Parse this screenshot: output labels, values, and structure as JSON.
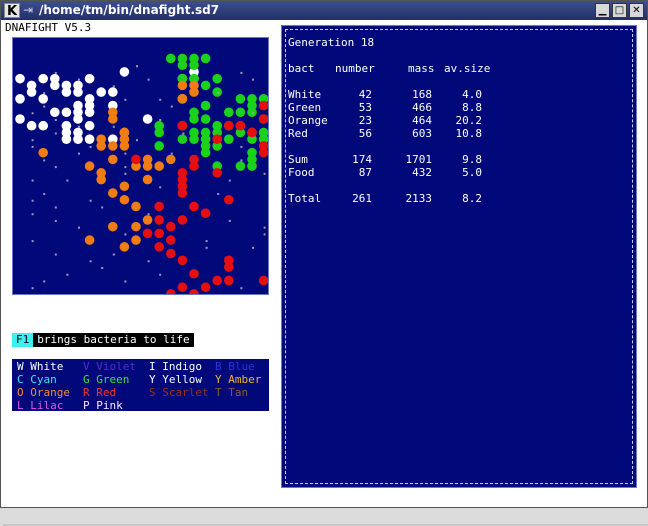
{
  "window": {
    "title": "/home/tm/bin/dnafight.sd7",
    "app_icon": "K",
    "buttons": [
      "minimize",
      "maximize",
      "close"
    ]
  },
  "app": {
    "title": "DNAFIGHT V5.3"
  },
  "colors": {
    "field_bg": "#00087a",
    "white": "#ffffff",
    "green": "#19d219",
    "orange": "#f07d14",
    "red": "#e60f0f",
    "food": "#9a9ab8"
  },
  "hint": {
    "key": "F1",
    "text": "brings bacteria to life"
  },
  "legend": [
    {
      "letter": "W",
      "name": "White",
      "color": "#ffffff"
    },
    {
      "letter": "V",
      "name": "Violet",
      "color": "#5a2ad2"
    },
    {
      "letter": "I",
      "name": "Indigo",
      "color": "#ffffff"
    },
    {
      "letter": "B",
      "name": "Blue",
      "color": "#2a34d8"
    },
    {
      "letter": "C",
      "name": "Cyan",
      "color": "#3ce6f0"
    },
    {
      "letter": "G",
      "name": "Green",
      "color": "#32e632"
    },
    {
      "letter": "Y",
      "name": "Yellow",
      "color": "#ffffff"
    },
    {
      "letter": "Y",
      "name": "Amber",
      "color": "#f0b432"
    },
    {
      "letter": "O",
      "name": "Orange",
      "color": "#f08c32"
    },
    {
      "letter": "R",
      "name": "Red",
      "color": "#f03232"
    },
    {
      "letter": "S",
      "name": "Scarlet",
      "color": "#96321e"
    },
    {
      "letter": "T",
      "name": "Tan",
      "color": "#8c5a32"
    },
    {
      "letter": "L",
      "name": "Lilac",
      "color": "#e650f0"
    },
    {
      "letter": "P",
      "name": "Pink",
      "color": "#ffe6ff"
    }
  ],
  "stats": {
    "generation": "Generation 18",
    "headers": [
      "bact",
      "number",
      "mass",
      "av.size"
    ],
    "rows": [
      {
        "name": "White",
        "number": "42",
        "mass": "168",
        "avsize": "4.0"
      },
      {
        "name": "Green",
        "number": "53",
        "mass": "466",
        "avsize": "8.8"
      },
      {
        "name": "Orange",
        "number": "23",
        "mass": "464",
        "avsize": "20.2"
      },
      {
        "name": "Red",
        "number": "56",
        "mass": "603",
        "avsize": "10.8"
      }
    ],
    "summary": [
      {
        "name": "Sum",
        "number": "174",
        "mass": "1701",
        "avsize": "9.8"
      },
      {
        "name": "Food",
        "number": "87",
        "mass": "432",
        "avsize": "5.0"
      }
    ],
    "total": {
      "name": "Total",
      "number": "261",
      "mass": "2133",
      "avsize": "8.2"
    }
  },
  "field": {
    "bacteria": {
      "white": [
        [
          4,
          9
        ],
        [
          4,
          15
        ],
        [
          5,
          0
        ],
        [
          5,
          2
        ],
        [
          5,
          3
        ],
        [
          5,
          6
        ],
        [
          5,
          14
        ],
        [
          5,
          15
        ],
        [
          6,
          1
        ],
        [
          6,
          3
        ],
        [
          6,
          4
        ],
        [
          6,
          5
        ],
        [
          7,
          1
        ],
        [
          7,
          4
        ],
        [
          7,
          5
        ],
        [
          7,
          7
        ],
        [
          7,
          8
        ],
        [
          8,
          0
        ],
        [
          8,
          2
        ],
        [
          8,
          6
        ],
        [
          8,
          14
        ],
        [
          9,
          5
        ],
        [
          9,
          6
        ],
        [
          9,
          8
        ],
        [
          10,
          3
        ],
        [
          10,
          4
        ],
        [
          10,
          5
        ],
        [
          10,
          6
        ],
        [
          11,
          0
        ],
        [
          11,
          5
        ],
        [
          11,
          11
        ],
        [
          12,
          1
        ],
        [
          12,
          2
        ],
        [
          12,
          4
        ],
        [
          12,
          6
        ],
        [
          13,
          4
        ],
        [
          13,
          5
        ],
        [
          13,
          9
        ],
        [
          14,
          4
        ],
        [
          14,
          5
        ],
        [
          14,
          6
        ],
        [
          14,
          8
        ]
      ],
      "green": [
        [
          2,
          13
        ],
        [
          2,
          14
        ],
        [
          2,
          15
        ],
        [
          2,
          16
        ],
        [
          3,
          14
        ],
        [
          3,
          15
        ],
        [
          5,
          14
        ],
        [
          5,
          15
        ],
        [
          5,
          17
        ],
        [
          6,
          16
        ],
        [
          7,
          17
        ],
        [
          8,
          19
        ],
        [
          8,
          20
        ],
        [
          8,
          21
        ],
        [
          9,
          16
        ],
        [
          9,
          20
        ],
        [
          9,
          22
        ],
        [
          10,
          15
        ],
        [
          10,
          18
        ],
        [
          10,
          19
        ],
        [
          10,
          20
        ],
        [
          11,
          15
        ],
        [
          11,
          16
        ],
        [
          11,
          21
        ],
        [
          12,
          12
        ],
        [
          12,
          14
        ],
        [
          12,
          17
        ],
        [
          12,
          18
        ],
        [
          12,
          19
        ],
        [
          13,
          12
        ],
        [
          13,
          15
        ],
        [
          13,
          16
        ],
        [
          13,
          17
        ],
        [
          13,
          19
        ],
        [
          13,
          20
        ],
        [
          13,
          21
        ],
        [
          14,
          14
        ],
        [
          14,
          15
        ],
        [
          14,
          16
        ],
        [
          14,
          17
        ],
        [
          14,
          18
        ],
        [
          14,
          20
        ],
        [
          14,
          21
        ],
        [
          15,
          12
        ],
        [
          15,
          16
        ],
        [
          15,
          17
        ],
        [
          16,
          16
        ],
        [
          16,
          20
        ],
        [
          17,
          20
        ],
        [
          17,
          23
        ],
        [
          18,
          17
        ],
        [
          18,
          19
        ],
        [
          18,
          20
        ]
      ],
      "orange": [
        [
          6,
          14
        ],
        [
          6,
          15
        ],
        [
          7,
          15
        ],
        [
          8,
          14
        ],
        [
          10,
          8
        ],
        [
          11,
          8
        ],
        [
          13,
          9
        ],
        [
          14,
          7
        ],
        [
          14,
          9
        ],
        [
          15,
          7
        ],
        [
          15,
          8
        ],
        [
          15,
          9
        ],
        [
          16,
          2
        ],
        [
          17,
          8
        ],
        [
          17,
          11
        ],
        [
          17,
          13
        ],
        [
          18,
          6
        ],
        [
          18,
          10
        ],
        [
          18,
          11
        ],
        [
          18,
          12
        ],
        [
          19,
          7
        ],
        [
          20,
          7
        ],
        [
          20,
          11
        ],
        [
          21,
          9
        ],
        [
          22,
          8
        ],
        [
          23,
          9
        ],
        [
          24,
          10
        ],
        [
          26,
          11
        ],
        [
          27,
          8
        ],
        [
          27,
          10
        ],
        [
          29,
          6
        ],
        [
          29,
          10
        ],
        [
          30,
          9
        ]
      ],
      "red": [
        [
          8,
          22
        ],
        [
          9,
          21
        ],
        [
          9,
          23
        ],
        [
          10,
          23
        ],
        [
          11,
          21
        ],
        [
          11,
          23
        ],
        [
          12,
          14
        ],
        [
          12,
          18
        ],
        [
          12,
          19
        ],
        [
          13,
          20
        ],
        [
          14,
          17
        ],
        [
          15,
          21
        ],
        [
          16,
          21
        ],
        [
          16,
          22
        ],
        [
          17,
          10
        ],
        [
          17,
          15
        ],
        [
          18,
          15
        ],
        [
          19,
          14
        ],
        [
          19,
          17
        ],
        [
          20,
          14
        ],
        [
          21,
          14
        ],
        [
          22,
          14
        ],
        [
          23,
          18
        ],
        [
          24,
          12
        ],
        [
          24,
          15
        ],
        [
          25,
          16
        ],
        [
          26,
          12
        ],
        [
          26,
          14
        ],
        [
          27,
          13
        ],
        [
          28,
          11
        ],
        [
          28,
          12
        ],
        [
          29,
          13
        ],
        [
          30,
          12
        ],
        [
          31,
          13
        ],
        [
          32,
          14
        ],
        [
          32,
          18
        ],
        [
          33,
          18
        ],
        [
          34,
          15
        ],
        [
          35,
          17
        ],
        [
          35,
          18
        ],
        [
          35,
          21
        ],
        [
          35,
          22
        ],
        [
          36,
          14
        ],
        [
          36,
          16
        ],
        [
          37,
          13
        ],
        [
          37,
          15
        ],
        [
          38,
          16
        ],
        [
          38,
          18
        ],
        [
          39,
          15
        ],
        [
          39,
          17
        ],
        [
          40,
          17
        ],
        [
          40,
          21
        ],
        [
          41,
          19
        ],
        [
          41,
          20
        ],
        [
          41,
          22
        ],
        [
          42,
          21
        ]
      ],
      "food": [
        [
          3,
          10
        ],
        [
          4,
          19
        ],
        [
          5,
          5
        ],
        [
          5,
          11
        ],
        [
          5,
          20
        ],
        [
          7,
          2
        ],
        [
          7,
          17
        ],
        [
          8,
          9
        ],
        [
          9,
          13
        ],
        [
          9,
          23
        ],
        [
          10,
          1
        ],
        [
          11,
          12
        ],
        [
          12,
          22
        ],
        [
          13,
          3
        ],
        [
          14,
          10
        ],
        [
          15,
          6
        ],
        [
          15,
          19
        ],
        [
          16,
          13
        ],
        [
          17,
          2
        ],
        [
          18,
          9
        ],
        [
          19,
          21
        ],
        [
          20,
          4
        ],
        [
          21,
          12
        ],
        [
          22,
          17
        ],
        [
          23,
          6
        ],
        [
          24,
          22
        ],
        [
          25,
          1
        ],
        [
          26,
          18
        ],
        [
          27,
          5
        ],
        [
          28,
          21
        ],
        [
          29,
          1
        ],
        [
          30,
          16
        ],
        [
          31,
          8
        ],
        [
          32,
          11
        ],
        [
          33,
          22
        ],
        [
          34,
          4
        ],
        [
          35,
          9
        ],
        [
          36,
          19
        ],
        [
          37,
          2
        ],
        [
          38,
          11
        ],
        [
          39,
          20
        ],
        [
          40,
          7
        ],
        [
          41,
          14
        ],
        [
          42,
          3
        ],
        [
          10,
          20
        ],
        [
          12,
          8
        ],
        [
          14,
          1
        ],
        [
          16,
          9
        ],
        [
          18,
          3
        ],
        [
          20,
          18
        ],
        [
          22,
          2
        ],
        [
          24,
          7
        ],
        [
          26,
          3
        ],
        [
          28,
          9
        ],
        [
          30,
          20
        ],
        [
          32,
          6
        ],
        [
          34,
          12
        ],
        [
          36,
          1
        ],
        [
          38,
          5
        ],
        [
          40,
          11
        ],
        [
          42,
          17
        ],
        [
          6,
          8
        ],
        [
          8,
          12
        ],
        [
          11,
          3
        ],
        [
          13,
          14
        ],
        [
          15,
          1
        ],
        [
          17,
          19
        ],
        [
          19,
          9
        ],
        [
          21,
          22
        ],
        [
          23,
          1
        ],
        [
          25,
          11
        ],
        [
          27,
          21
        ],
        [
          29,
          16
        ],
        [
          31,
          3
        ],
        [
          33,
          7
        ],
        [
          35,
          2
        ],
        [
          37,
          22
        ],
        [
          39,
          7
        ],
        [
          41,
          5
        ],
        [
          43,
          13
        ],
        [
          4,
          3
        ],
        [
          6,
          22
        ],
        [
          9,
          2
        ],
        [
          12,
          5
        ],
        [
          16,
          5
        ],
        [
          20,
          1
        ],
        [
          24,
          3
        ]
      ]
    }
  }
}
